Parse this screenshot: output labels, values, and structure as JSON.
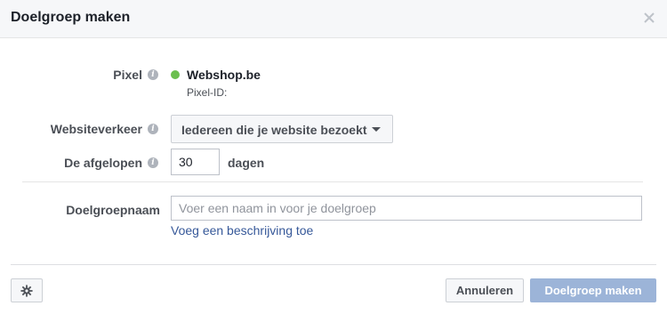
{
  "dialog": {
    "title": "Doelgroep maken",
    "close_icon": "close-icon"
  },
  "form": {
    "pixel": {
      "label": "Pixel",
      "status_color": "#6bbf4e",
      "name": "Webshop.be",
      "id_label": "Pixel-ID:"
    },
    "website_traffic": {
      "label": "Websiteverkeer",
      "selected": "Iedereen die je website bezoekt"
    },
    "last_days": {
      "label": "De afgelopen",
      "value": "30",
      "unit": "dagen"
    },
    "audience_name": {
      "label": "Doelgroepnaam",
      "placeholder": "Voer een naam in voor je doelgroep",
      "value": "",
      "add_description_link": "Voeg een beschrijving toe"
    }
  },
  "footer": {
    "settings_icon": "gear-icon",
    "cancel_label": "Annuleren",
    "submit_label": "Doelgroep maken"
  },
  "colors": {
    "link": "#365899",
    "submit_disabled": "#9cb4d8"
  }
}
